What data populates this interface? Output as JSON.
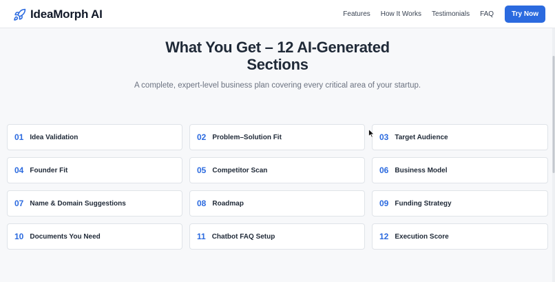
{
  "header": {
    "brand": {
      "name": "IdeaMorph AI",
      "icon": "rocket-icon"
    },
    "nav": [
      "Features",
      "How It Works",
      "Testimonials",
      "FAQ"
    ],
    "cta_label": "Try Now"
  },
  "hero": {
    "title": "What You Get – 12 AI-Generated Sections",
    "subtitle": "A complete, expert-level business plan covering every critical area of your startup."
  },
  "sections": [
    {
      "num": "01",
      "label": "Idea Validation"
    },
    {
      "num": "02",
      "label": "Problem–Solution Fit"
    },
    {
      "num": "03",
      "label": "Target Audience"
    },
    {
      "num": "04",
      "label": "Founder Fit"
    },
    {
      "num": "05",
      "label": "Competitor Scan"
    },
    {
      "num": "06",
      "label": "Business Model"
    },
    {
      "num": "07",
      "label": "Name & Domain Suggestions"
    },
    {
      "num": "08",
      "label": "Roadmap"
    },
    {
      "num": "09",
      "label": "Funding Strategy"
    },
    {
      "num": "10",
      "label": "Documents You Need"
    },
    {
      "num": "11",
      "label": "Chatbot FAQ Setup"
    },
    {
      "num": "12",
      "label": "Execution Score"
    }
  ],
  "colors": {
    "accent": "#2b6adf",
    "text": "#1f2937",
    "muted": "#6b7280",
    "background": "#f7f8fa"
  }
}
